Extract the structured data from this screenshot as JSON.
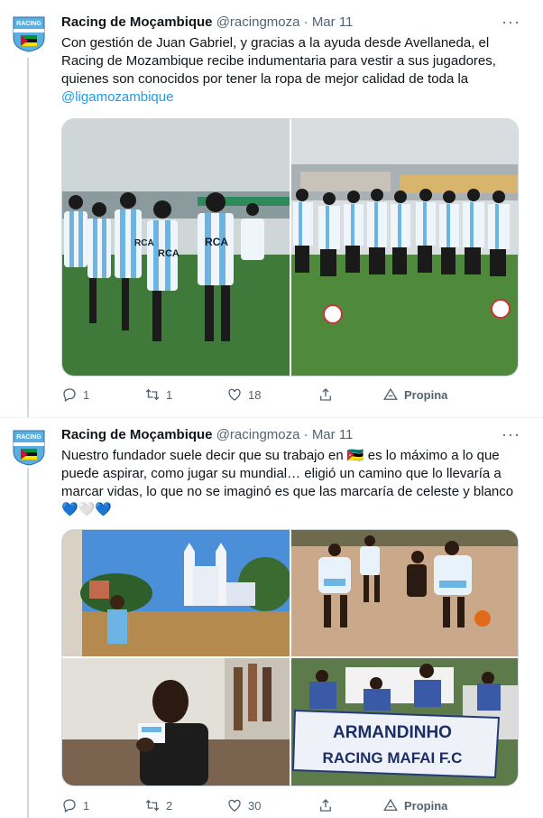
{
  "tweets": [
    {
      "name": "Racing de Moçambique",
      "handle": "@racingmoza",
      "sep": "·",
      "date": "Mar 11",
      "text_before": "Con gestión de Juan Gabriel, y gracias a la ayuda desde Avellaneda, el Racing de Mozambique recibe indumentaria para vestir a sus jugadores, quienes son conocidos por tener la ropa de mejor calidad de toda la",
      "mention": "@ligamozambique",
      "replies": "1",
      "retweets": "1",
      "likes": "18",
      "tip": "Propina"
    },
    {
      "name": "Racing de Moçambique",
      "handle": "@racingmoza",
      "sep": "·",
      "date": "Mar 11",
      "text_a": "Nuestro fundador suele decir que su trabajo en",
      "flag": "🇲🇿",
      "text_b": "es lo máximo a lo que puede aspirar, como jugar su mundial… eligió un camino que lo llevaría a marcar vidas, lo que no se imaginó es que las marcaría de celeste y blanco",
      "hearts": "💙🤍💙",
      "replies": "1",
      "retweets": "2",
      "likes": "30",
      "tip": "Propina"
    }
  ],
  "avatar_label": "RACING",
  "more_label": "···",
  "photos": {
    "banner_line1": "ARMANDINHO",
    "banner_line2": "RACING MAFAI F.C",
    "shirt_label": "RCA"
  },
  "colors": {
    "accent": "#1d9bf0",
    "racing_blue": "#6cb4e4",
    "text": "#0f1419",
    "muted": "#536471"
  },
  "icons": [
    "reply-icon",
    "retweet-icon",
    "like-icon",
    "share-icon",
    "tip-icon",
    "more-icon"
  ]
}
